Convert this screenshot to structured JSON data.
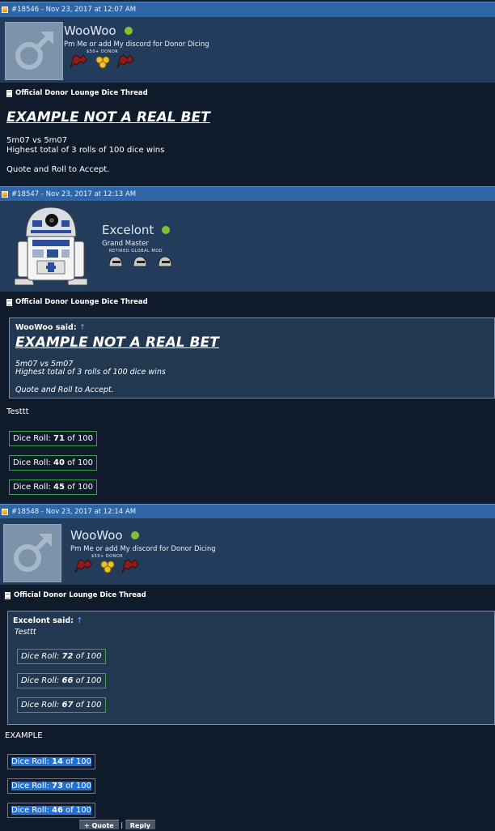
{
  "posts": [
    {
      "header": "#18546 - Nov 23, 2017 at 12:07 AM",
      "username": "WooWoo",
      "tagline": "Pm Me or add My discord for Donor Dicing",
      "badge_label": "$50+ DONOR",
      "thread_title": "Official Donor Lounge Dice Thread",
      "big_title": "EXAMPLE NOT A REAL BET",
      "body_line1": "5m07 vs 5m07",
      "body_line2": "Highest total of 3 rolls of 100 dice wins",
      "body_line3": "Quote and Roll to Accept."
    },
    {
      "header": "#18547 - Nov 23, 2017 at 12:13 AM",
      "username": "Excelont",
      "tagline": "Grand Master",
      "badge_label": "RETIRED GLOBAL MOD",
      "thread_title": "Official Donor Lounge Dice Thread",
      "quote_author": "WooWoo said:",
      "quote_arrow": "↑",
      "quote_title": "EXAMPLE NOT A REAL BET",
      "quote_line1": "5m07 vs 5m07",
      "quote_line2": "Highest total of 3 rolls of 100 dice wins",
      "quote_line3": "Quote and Roll to Accept.",
      "message": "Testtt",
      "rolls": [
        {
          "prefix": "Dice Roll: ",
          "value": "71",
          "suffix": " of 100"
        },
        {
          "prefix": "Dice Roll: ",
          "value": "40",
          "suffix": " of 100"
        },
        {
          "prefix": "Dice Roll: ",
          "value": "45",
          "suffix": " of 100"
        }
      ]
    },
    {
      "header": "#18548 - Nov 23, 2017 at 12:14 AM",
      "username": "WooWoo",
      "tagline": "Pm Me or add My discord for Donor Dicing",
      "badge_label": "$50+ DONOR",
      "thread_title": "Official Donor Lounge Dice Thread",
      "quote_author": "Excelont said:",
      "quote_arrow": "↑",
      "quote_message": "Testtt",
      "quote_rolls": [
        {
          "prefix": "Dice Roll: ",
          "value": "72",
          "suffix": " of 100"
        },
        {
          "prefix": "Dice Roll: ",
          "value": "66",
          "suffix": " of 100"
        },
        {
          "prefix": "Dice Roll: ",
          "value": "67",
          "suffix": " of 100"
        }
      ],
      "message": "EXAMPLE",
      "rolls": [
        {
          "prefix": "Dice Roll: ",
          "value": "14",
          "suffix": " of 100"
        },
        {
          "prefix": "Dice Roll: ",
          "value": "73",
          "suffix": " of 100"
        },
        {
          "prefix": "Dice Roll: ",
          "value": "46",
          "suffix": " of 100"
        }
      ]
    }
  ],
  "buttons": {
    "quote": "+ Quote",
    "reply": "Reply"
  },
  "icons": {
    "post_icon": "post-icon",
    "document_icon": "document-icon",
    "online_icon": "online-status-icon",
    "default_avatar": "male-symbol-avatar",
    "robot_avatar": "r2d2-avatar"
  },
  "colors": {
    "header_bar": "#2f67a6",
    "user_row": "#243c5c",
    "background": "#0f1a2b",
    "dice_border": "#39a34a",
    "online": "#7dc231",
    "selection": "#1e6fd6"
  }
}
